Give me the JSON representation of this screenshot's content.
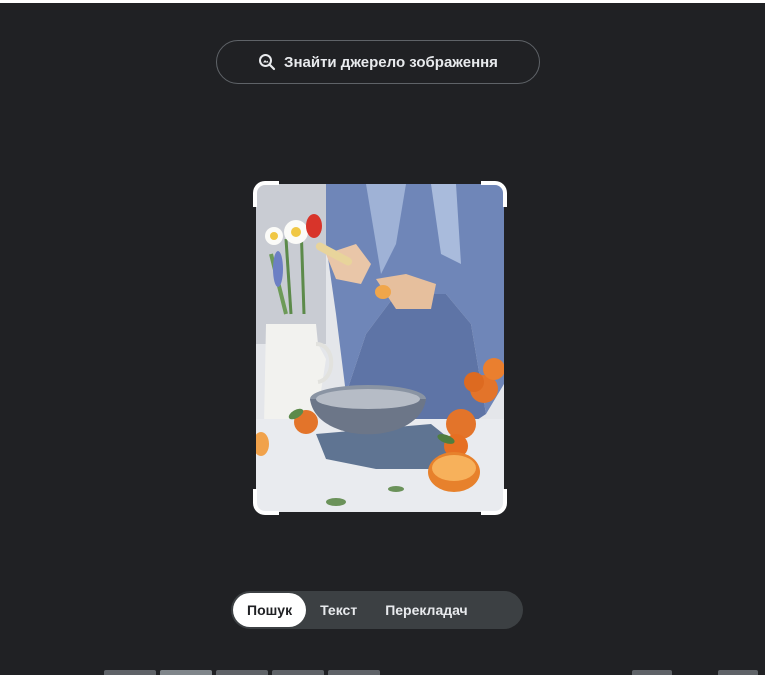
{
  "source_button": {
    "label": "Знайти джерело зображення",
    "icon": "image-search-icon"
  },
  "image": {
    "alt": "watercolor painting",
    "colors": {
      "background": "#e4e6ea",
      "shirt": "#6f86b8",
      "orange": "#e3742a",
      "bowl": "#7a8493",
      "vase": "#f2f2ef"
    }
  },
  "tabs": [
    {
      "label": "Пошук",
      "active": true
    },
    {
      "label": "Текст",
      "active": false
    },
    {
      "label": "Перекладач",
      "active": false
    }
  ],
  "colors": {
    "background": "#202124",
    "border": "#5f6368",
    "text": "#e8eaed",
    "active_tab_bg": "#ffffff"
  }
}
